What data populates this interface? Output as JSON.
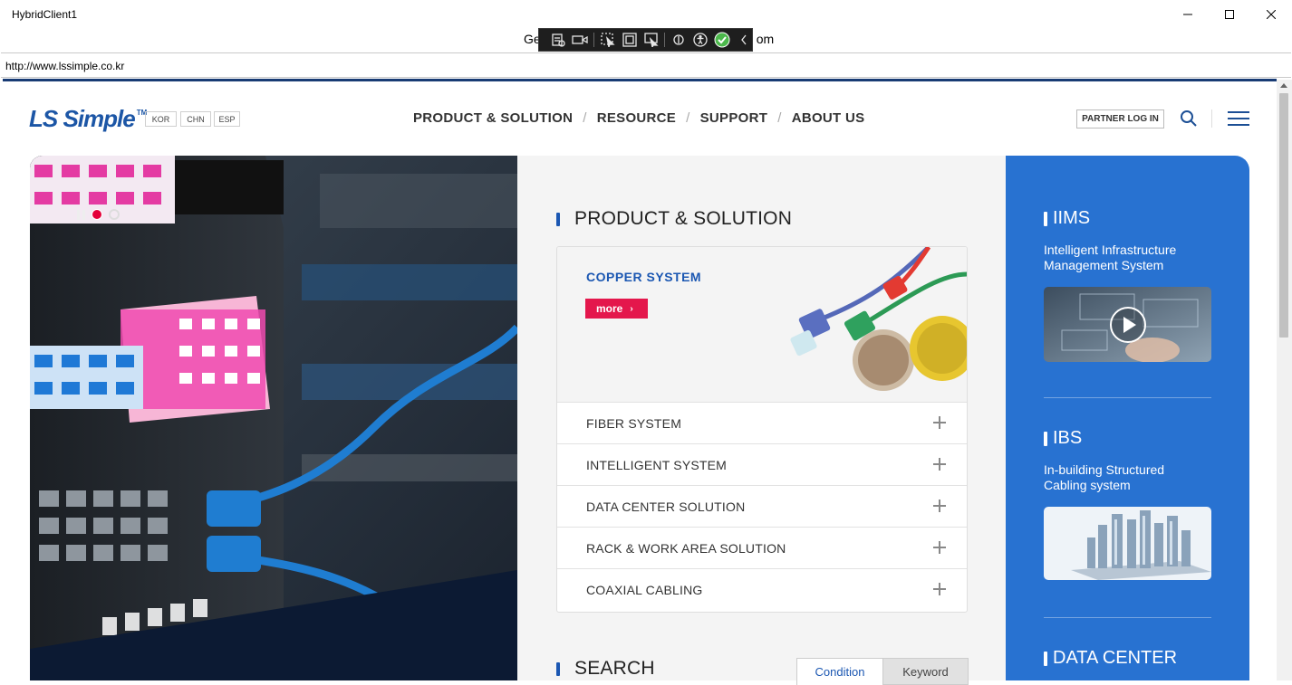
{
  "window": {
    "title": "HybridClient1",
    "caption_left": "Ge",
    "caption_right": "om"
  },
  "address": {
    "url": "http://www.lssimple.co.kr"
  },
  "header": {
    "logo_text": "LS Simple",
    "logo_tm": "TM",
    "languages": [
      "KOR",
      "CHN",
      "ESP"
    ],
    "nav": [
      "PRODUCT & SOLUTION",
      "RESOURCE",
      "SUPPORT",
      "ABOUT US"
    ],
    "nav_separator": "/",
    "partner_login": "PARTNER LOG IN"
  },
  "product_solution": {
    "title": "PRODUCT & SOLUTION",
    "featured": {
      "title": "COPPER SYSTEM",
      "more_label": "more",
      "more_arrow": "›"
    },
    "items": [
      "FIBER SYSTEM",
      "INTELLIGENT SYSTEM",
      "DATA CENTER SOLUTION",
      "RACK & WORK AREA SOLUTION",
      "COAXIAL CABLING"
    ]
  },
  "search": {
    "title": "SEARCH",
    "tabs": [
      "Condition",
      "Keyword"
    ]
  },
  "sidebar": [
    {
      "title": "IIMS",
      "desc1": "Intelligent Infrastructure",
      "desc2": "Management System"
    },
    {
      "title": "IBS",
      "desc1": "In-building Structured",
      "desc2": "Cabling system"
    },
    {
      "title": "DATA CENTER"
    }
  ],
  "colors": {
    "brand_blue": "#1c56a6",
    "accent_red": "#e4174c",
    "panel_blue": "#2872d1"
  }
}
